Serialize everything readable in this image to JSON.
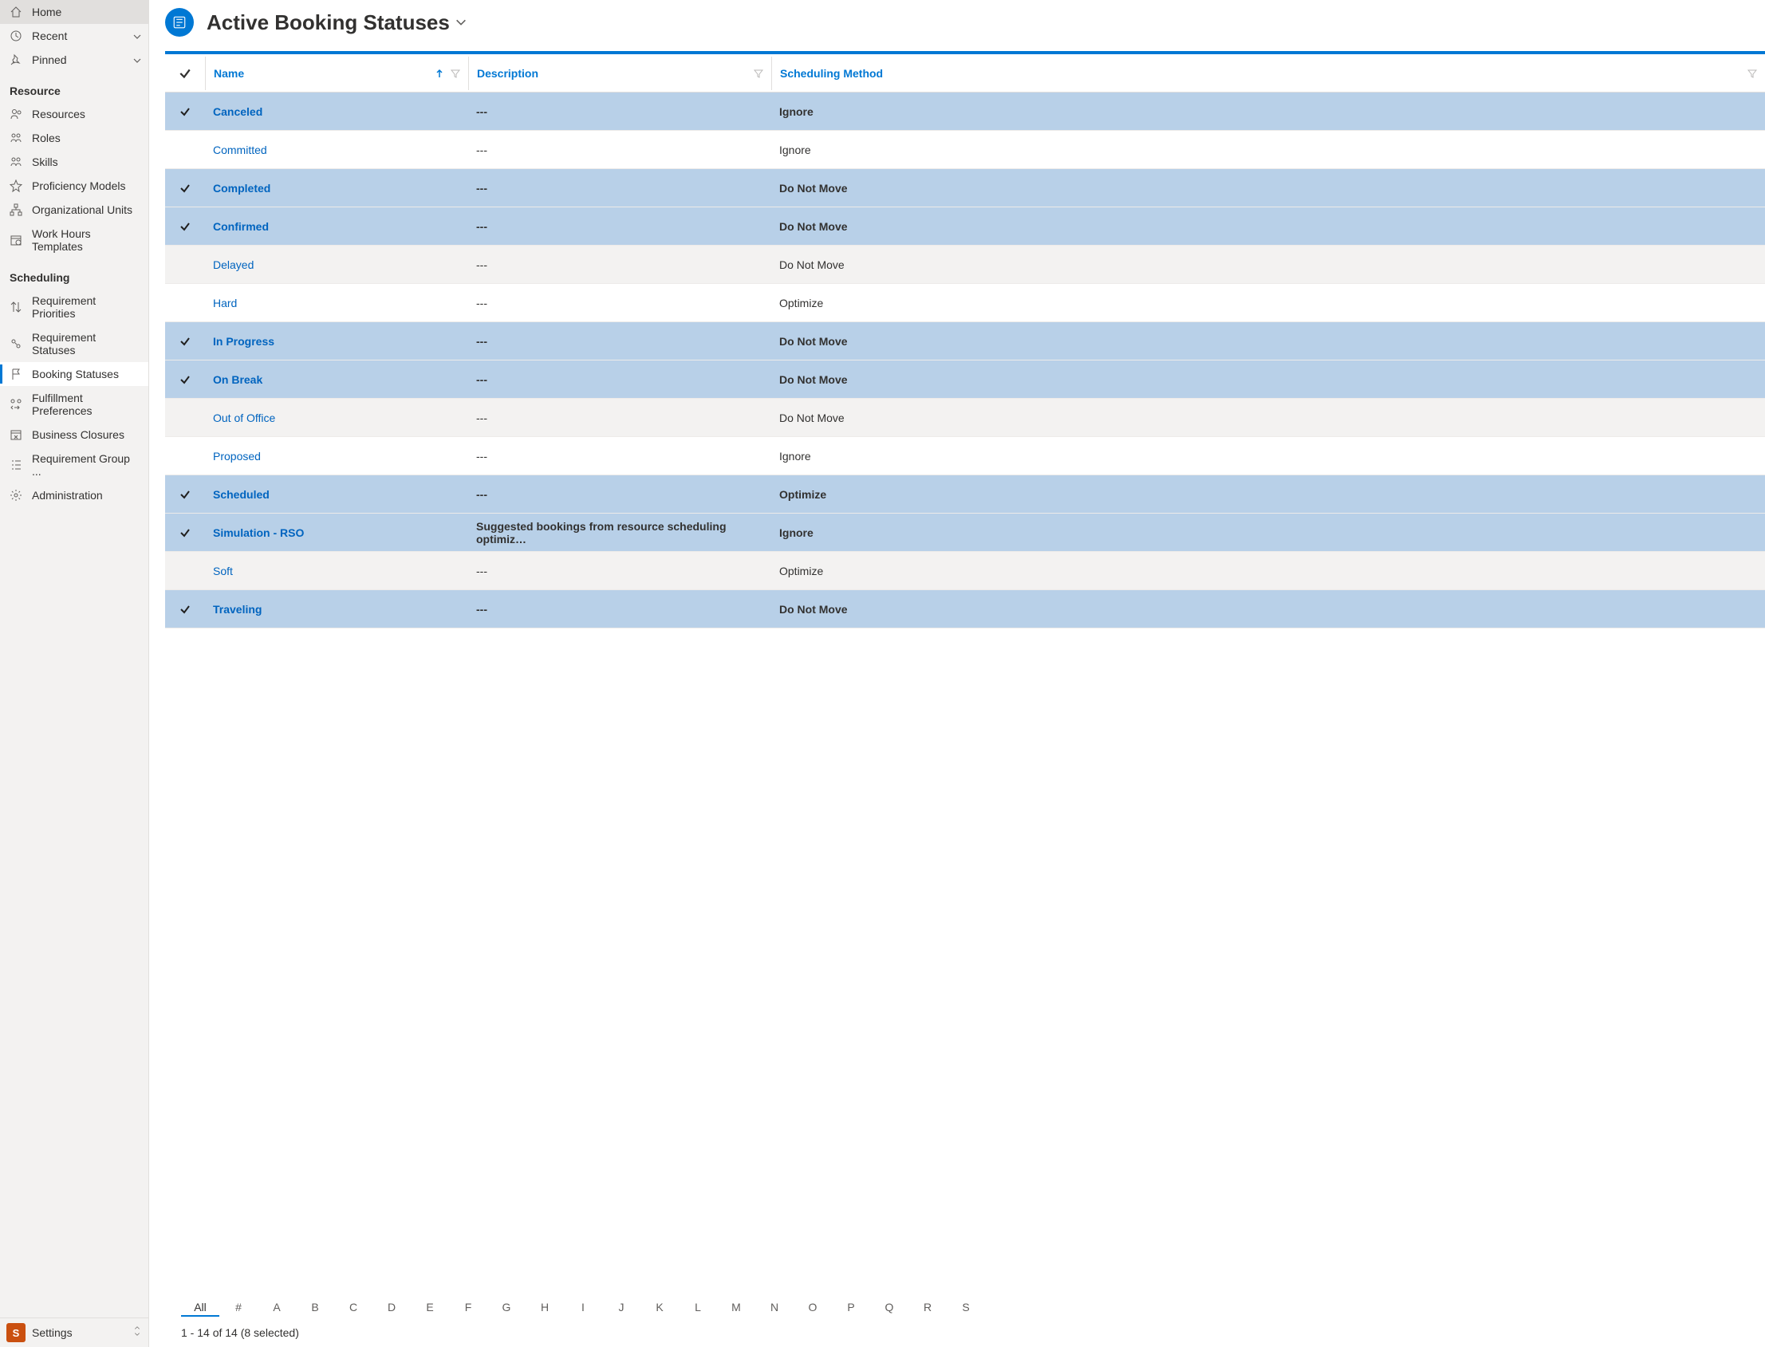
{
  "sidebar": {
    "top": [
      {
        "icon": "home",
        "label": "Home",
        "expandable": false
      },
      {
        "icon": "clock",
        "label": "Recent",
        "expandable": true
      },
      {
        "icon": "pin",
        "label": "Pinned",
        "expandable": true
      }
    ],
    "resource_title": "Resource",
    "resource_items": [
      {
        "icon": "people",
        "label": "Resources"
      },
      {
        "icon": "person-group",
        "label": "Roles"
      },
      {
        "icon": "person-gear",
        "label": "Skills"
      },
      {
        "icon": "star",
        "label": "Proficiency Models"
      },
      {
        "icon": "org",
        "label": "Organizational Units"
      },
      {
        "icon": "calendar-clock",
        "label": "Work Hours Templates"
      }
    ],
    "scheduling_title": "Scheduling",
    "scheduling_items": [
      {
        "icon": "sort",
        "label": "Requirement Priorities",
        "active": false
      },
      {
        "icon": "people-link",
        "label": "Requirement Statuses",
        "active": false
      },
      {
        "icon": "flag",
        "label": "Booking Statuses",
        "active": true
      },
      {
        "icon": "people-swap",
        "label": "Fulfillment Preferences",
        "active": false
      },
      {
        "icon": "calendar-x",
        "label": "Business Closures",
        "active": false
      },
      {
        "icon": "list-group",
        "label": "Requirement Group ...",
        "active": false
      },
      {
        "icon": "gear",
        "label": "Administration",
        "active": false
      }
    ],
    "settings_badge": "S",
    "settings_label": "Settings"
  },
  "page": {
    "title": "Active Booking Statuses"
  },
  "grid": {
    "columns": {
      "name": "Name",
      "description": "Description",
      "scheduling_method": "Scheduling Method"
    },
    "rows": [
      {
        "selected": true,
        "name": "Canceled",
        "description": "---",
        "method": "Ignore"
      },
      {
        "selected": false,
        "name": "Committed",
        "description": "---",
        "method": "Ignore"
      },
      {
        "selected": true,
        "name": "Completed",
        "description": "---",
        "method": "Do Not Move"
      },
      {
        "selected": true,
        "name": "Confirmed",
        "description": "---",
        "method": "Do Not Move"
      },
      {
        "selected": false,
        "name": "Delayed",
        "description": "---",
        "method": "Do Not Move"
      },
      {
        "selected": false,
        "name": "Hard",
        "description": "---",
        "method": "Optimize"
      },
      {
        "selected": true,
        "name": "In Progress",
        "description": "---",
        "method": "Do Not Move"
      },
      {
        "selected": true,
        "name": "On Break",
        "description": "---",
        "method": "Do Not Move"
      },
      {
        "selected": false,
        "name": "Out of Office",
        "description": "---",
        "method": "Do Not Move"
      },
      {
        "selected": false,
        "name": "Proposed",
        "description": "---",
        "method": "Ignore"
      },
      {
        "selected": true,
        "name": "Scheduled",
        "description": "---",
        "method": "Optimize"
      },
      {
        "selected": true,
        "name": "Simulation - RSO",
        "description": "Suggested bookings from resource scheduling optimiz…",
        "method": "Ignore"
      },
      {
        "selected": false,
        "name": "Soft",
        "description": "---",
        "method": "Optimize"
      },
      {
        "selected": true,
        "name": "Traveling",
        "description": "---",
        "method": "Do Not Move"
      }
    ]
  },
  "alpha": [
    "All",
    "#",
    "A",
    "B",
    "C",
    "D",
    "E",
    "F",
    "G",
    "H",
    "I",
    "J",
    "K",
    "L",
    "M",
    "N",
    "O",
    "P",
    "Q",
    "R",
    "S"
  ],
  "status": "1 - 14 of 14 (8 selected)"
}
